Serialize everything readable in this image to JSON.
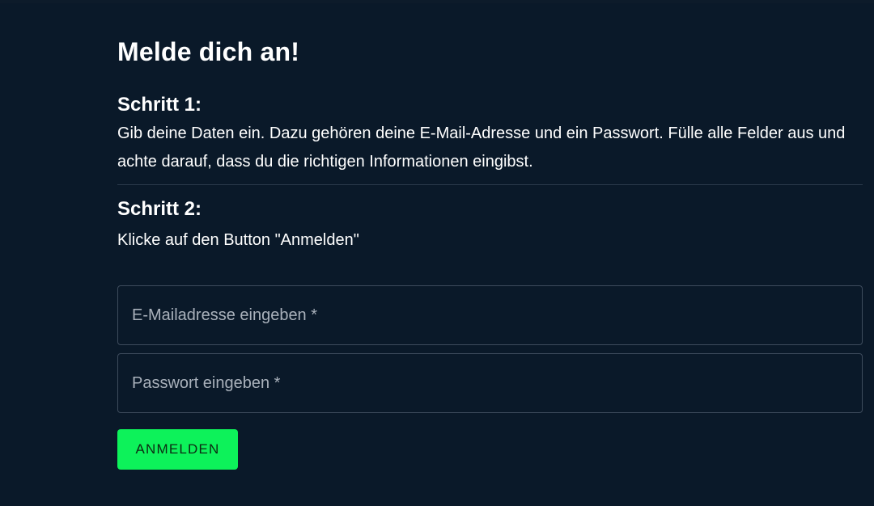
{
  "page": {
    "title": "Melde dich an!"
  },
  "steps": [
    {
      "heading": "Schritt 1:",
      "text": "Gib deine Daten ein. Dazu gehören deine E-Mail-Adresse und ein Passwort. Fülle alle Felder aus und achte darauf, dass du die richtigen Informationen eingibst."
    },
    {
      "heading": "Schritt 2:",
      "text": "Klicke auf den Button \"Anmelden\""
    }
  ],
  "form": {
    "email": {
      "placeholder": "E-Mailadresse eingeben *",
      "value": ""
    },
    "password": {
      "placeholder": "Passwort eingeben *",
      "value": ""
    },
    "submit_label": "ANMELDEN"
  },
  "colors": {
    "background": "#0a1929",
    "accent": "#0df25a",
    "input_border": "#3d4b5c"
  }
}
